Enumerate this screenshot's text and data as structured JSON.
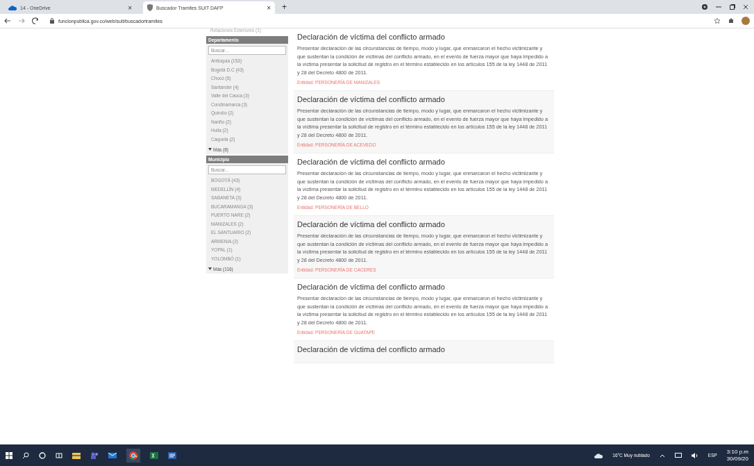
{
  "browser": {
    "tabs": [
      {
        "label": "14 - OneDrive",
        "selected": false,
        "close": "×"
      },
      {
        "label": "Buscador Tramites SUIT DAFP",
        "selected": true,
        "close": "×"
      }
    ],
    "new_tab": "+",
    "url": "funcionpublica.gov.co/web/suit/buscadortramites"
  },
  "sidebar": {
    "top_item": "Relaciones Exteriores (1)",
    "groups": [
      {
        "title": "Departamento",
        "placeholder": "Buscar...",
        "items": [
          "Antioquia (153)",
          "Bogotá D.C (43)",
          "Chocó (5)",
          "Santander (4)",
          "Valle del Cauca (3)",
          "Cundinamarca (3)",
          "Quindío (2)",
          "Nariño (2)",
          "Huila (2)",
          "Caquetá (2)"
        ],
        "more": "Más (8)"
      },
      {
        "title": "Municipio",
        "placeholder": "Buscar...",
        "items": [
          "BOGOTÁ (43)",
          "MEDELLÍN (4)",
          "SABANETA (3)",
          "BUCARAMANGA (3)",
          "PUERTO NARE (2)",
          "MANIZALES (2)",
          "EL SANTUARIO (2)",
          "ARMENIA (2)",
          "YOPAL (1)",
          "YOLOMBÓ (1)"
        ],
        "more": "Más (116)"
      }
    ]
  },
  "results": [
    {
      "title": "Declaración de víctima del conflicto armado",
      "description": "Presentar declaración de las circunstancias de tiempo, modo y lugar, que enmarcaron el hecho victimizante y que sustentan la condición de víctimas del conflicto armado, en el evento de fuerza mayor que haya impedido a la víctima presentar la solicitud de registro en el término establecido en los artículos 155 de la ley 1448 de 2011 y 28 del Decreto 4800 de 2011.",
      "entity": "Entidad: PERSONERÍA DE MANIZALES"
    },
    {
      "title": "Declaración de víctima del conflicto armado",
      "description": "Presentar declaración de las circunstancias de tiempo, modo y lugar, que enmarcaron el hecho victimizante y que sustentan la condición de víctimas del conflicto armado, en el evento de fuerza mayor que haya impedido a la víctima presentar la solicitud de registro en el término establecido en los artículos 155 de la ley 1448 de 2011 y 28 del Decreto 4800 de 2011.",
      "entity": "Entidad: PERSONERÍA DE ACEVEDO"
    },
    {
      "title": "Declaración de víctima del conflicto armado",
      "description": "Presentar declaración de las circunstancias de tiempo, modo y lugar, que enmarcaron el hecho victimizante y que sustentan la condición de víctimas del conflicto armado, en el evento de fuerza mayor que haya impedido a la víctima presentar la solicitud de registro en el término establecido en los artículos 155 de la ley 1448 de 2011 y 28 del Decreto 4800 de 2011.",
      "entity": "Entidad: PERSONERÍA DE BELLO"
    },
    {
      "title": "Declaración de víctima del conflicto armado",
      "description": "Presentar declaración de las circunstancias de tiempo, modo y lugar, que enmarcaron el hecho victimizante y que sustentan la condición de víctimas del conflicto armado, en el evento de fuerza mayor que haya impedido a la víctima presentar la solicitud de registro en el término establecido en los artículos 155 de la ley 1448 de 2011 y 28 del Decreto 4800 de 2011.",
      "entity": "Entidad: PERSONERÍA DE CACERES"
    },
    {
      "title": "Declaración de víctima del conflicto armado",
      "description": "Presentar declaración de las circunstancias de tiempo, modo y lugar, que enmarcaron el hecho victimizante y que sustentan la condición de víctimas del conflicto armado, en el evento de fuerza mayor que haya impedido a la víctima presentar la solicitud de registro en el término establecido en los artículos 155 de la ley 1448 de 2011 y 28 del Decreto 4800 de 2011.",
      "entity": "Entidad: PERSONERÍA DE GUATAPE"
    },
    {
      "title": "Declaración de víctima del conflicto armado"
    }
  ],
  "taskbar": {
    "weather": "16°C  Muy nublado",
    "language": "ESP",
    "time": "3:10 p.m",
    "date": "30/09/20"
  }
}
